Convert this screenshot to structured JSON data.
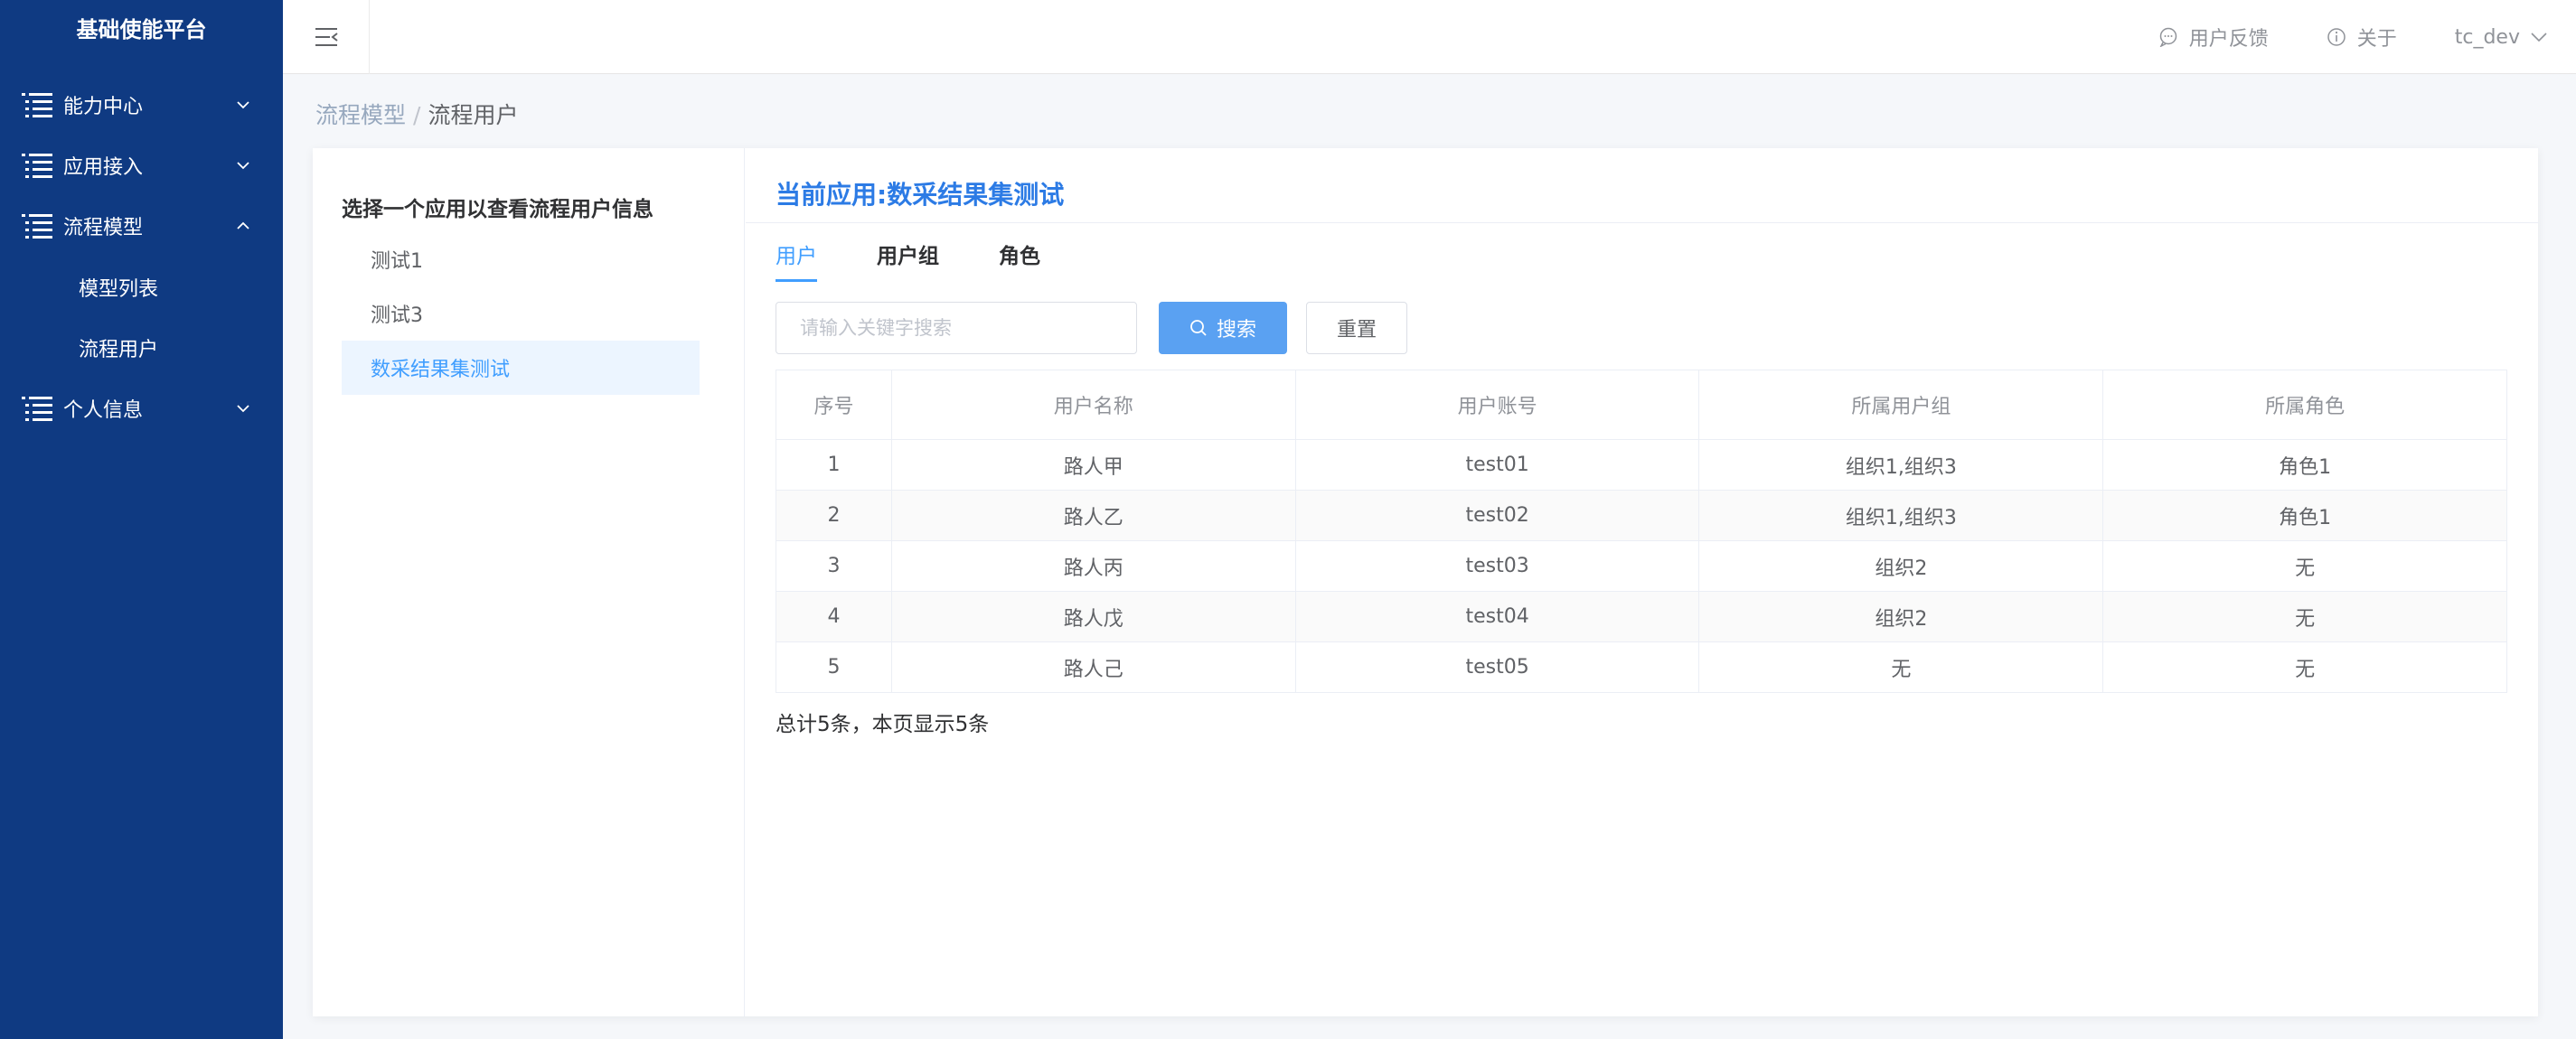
{
  "sidebar": {
    "app_title": "基础使能平台",
    "items": [
      {
        "label": "能力中心"
      },
      {
        "label": "应用接入"
      },
      {
        "label": "流程模型"
      },
      {
        "label": "个人信息"
      }
    ],
    "subitems": [
      {
        "label": "模型列表"
      },
      {
        "label": "流程用户"
      }
    ]
  },
  "header": {
    "feedback": "用户反馈",
    "about": "关于",
    "user": "tc_dev"
  },
  "breadcrumb": {
    "parent": "流程模型",
    "separator": "/",
    "current": "流程用户"
  },
  "left_panel": {
    "title": "选择一个应用以查看流程用户信息",
    "apps": [
      "测试1",
      "测试3",
      "数采结果集测试"
    ]
  },
  "right_panel": {
    "current_app": "当前应用:数采结果集测试",
    "tabs": [
      "用户",
      "用户组",
      "角色"
    ],
    "search_placeholder": "请输入关键字搜索",
    "search_button": "搜索",
    "reset_button": "重置"
  },
  "table": {
    "headers": [
      "序号",
      "用户名称",
      "用户账号",
      "所属用户组",
      "所属角色"
    ],
    "rows": [
      [
        "1",
        "路人甲",
        "test01",
        "组织1,组织3",
        "角色1"
      ],
      [
        "2",
        "路人乙",
        "test02",
        "组织1,组织3",
        "角色1"
      ],
      [
        "3",
        "路人丙",
        "test03",
        "组织2",
        "无"
      ],
      [
        "4",
        "路人戊",
        "test04",
        "组织2",
        "无"
      ],
      [
        "5",
        "路人己",
        "test05",
        "无",
        "无"
      ]
    ]
  },
  "footer": {
    "total": "总计5条，本页显示5条"
  },
  "colors": {
    "sidebar_bg": "#0f3a82",
    "accent": "#409eff",
    "title_blue": "#2c7be5"
  }
}
